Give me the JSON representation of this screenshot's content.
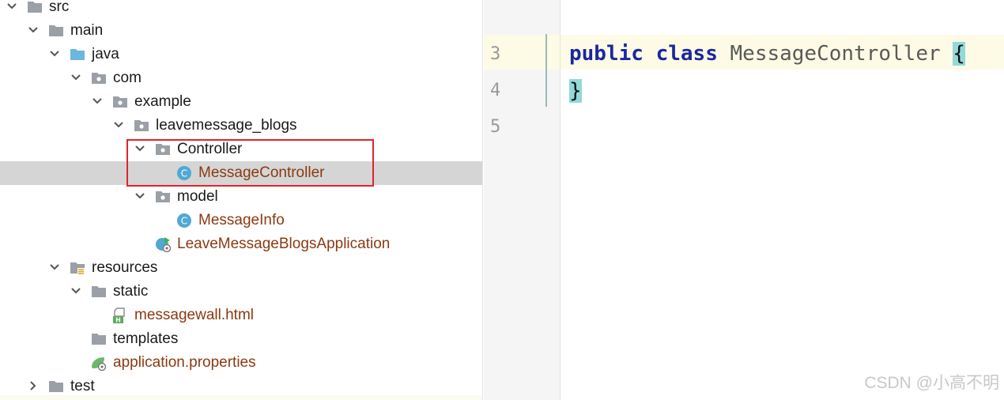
{
  "tree": {
    "rows": [
      {
        "label": "src"
      },
      {
        "label": "main"
      },
      {
        "label": "java"
      },
      {
        "label": "com"
      },
      {
        "label": "example"
      },
      {
        "label": "leavemessage_blogs"
      },
      {
        "label": "Controller"
      },
      {
        "label": "MessageController"
      },
      {
        "label": "model"
      },
      {
        "label": "MessageInfo"
      },
      {
        "label": "LeaveMessageBlogsApplication"
      },
      {
        "label": "resources"
      },
      {
        "label": "static"
      },
      {
        "label": "messagewall.html"
      },
      {
        "label": "templates"
      },
      {
        "label": "application.properties"
      },
      {
        "label": "test"
      }
    ],
    "class_badge": "C",
    "html_badge": "H"
  },
  "editor": {
    "line_numbers": [
      "3",
      "4",
      "5"
    ],
    "code": {
      "kw_public": "public",
      "kw_class": "class",
      "class_name": "MessageController",
      "open_brace": "{",
      "close_brace": "}"
    }
  },
  "watermark": "CSDN @小高不明",
  "colors": {
    "selection": "#d5d5d5",
    "highlight_box": "#e0232c",
    "file_label": "#8a3a10",
    "keyword": "#1a27a0",
    "brace_match": "#93d9d9",
    "current_line": "#fdfbe5"
  }
}
